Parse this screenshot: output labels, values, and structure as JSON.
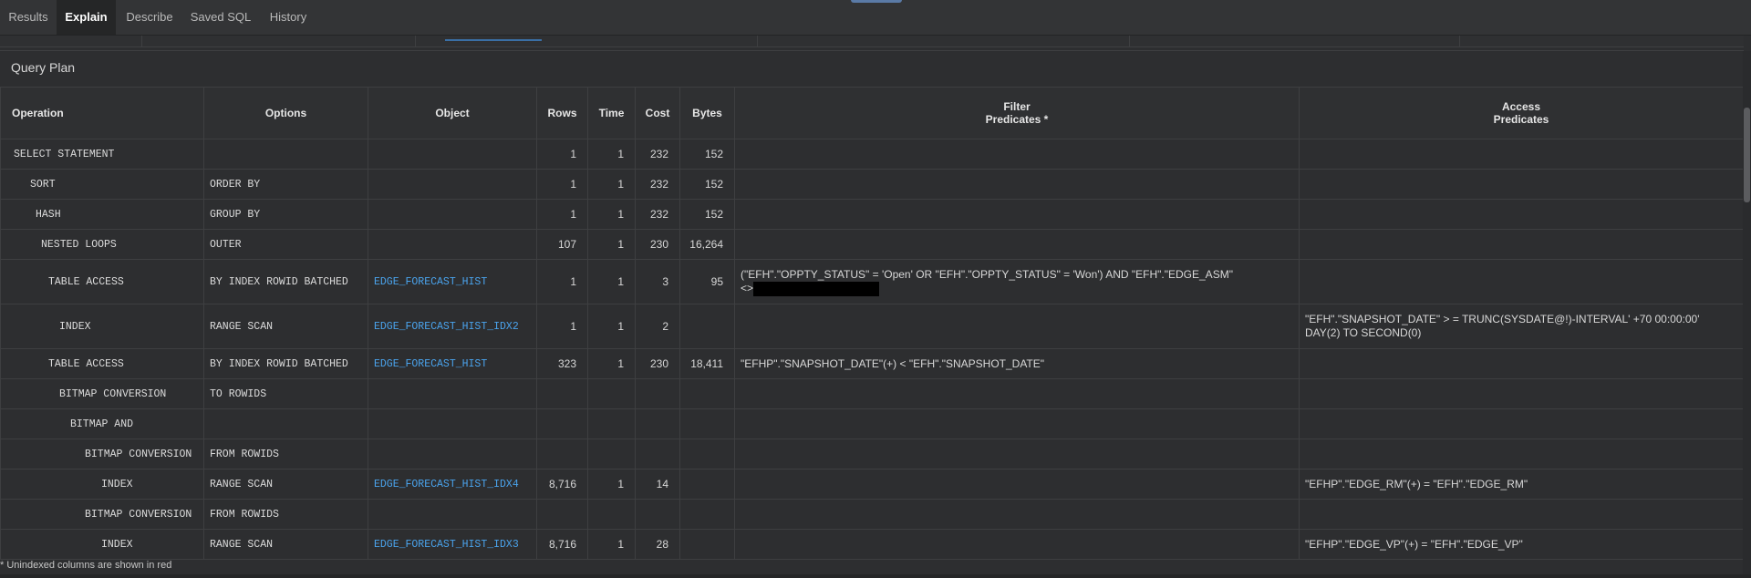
{
  "tabs": [
    {
      "label": "Results"
    },
    {
      "label": "Explain"
    },
    {
      "label": "Describe"
    },
    {
      "label": "Saved SQL"
    },
    {
      "label": "History"
    }
  ],
  "panel": {
    "title": "Query Plan"
  },
  "columns": {
    "operation": "Operation",
    "options": "Options",
    "object": "Object",
    "rows": "Rows",
    "time": "Time",
    "cost": "Cost",
    "bytes": "Bytes",
    "filter_line1": "Filter",
    "filter_line2": "Predicates *",
    "access_line1": "Access",
    "access_line2": "Predicates"
  },
  "plan": [
    {
      "operation": "SELECT STATEMENT",
      "indent": 0,
      "options": "",
      "object": "",
      "rows": "1",
      "time": "1",
      "cost": "232",
      "bytes": "152",
      "filter": "",
      "access": ""
    },
    {
      "operation": "SORT",
      "indent": 1,
      "options": "ORDER BY",
      "object": "",
      "rows": "1",
      "time": "1",
      "cost": "232",
      "bytes": "152",
      "filter": "",
      "access": ""
    },
    {
      "operation": "HASH",
      "indent": 2,
      "options": "GROUP BY",
      "object": "",
      "rows": "1",
      "time": "1",
      "cost": "232",
      "bytes": "152",
      "filter": "",
      "access": ""
    },
    {
      "operation": "NESTED LOOPS",
      "indent": 3,
      "options": "OUTER",
      "object": "",
      "rows": "107",
      "time": "1",
      "cost": "230",
      "bytes": "16,264",
      "filter": "",
      "access": ""
    },
    {
      "operation": "TABLE ACCESS",
      "indent": 4,
      "options": "BY INDEX ROWID BATCHED",
      "object": "EDGE_FORECAST_HIST",
      "rows": "1",
      "time": "1",
      "cost": "3",
      "bytes": "95",
      "filter": "(\"EFH\".\"OPPTY_STATUS\" = 'Open' OR \"EFH\".\"OPPTY_STATUS\" = 'Won') AND \"EFH\".\"EDGE_ASM\"",
      "filter_tail": "<>",
      "access": ""
    },
    {
      "operation": "INDEX",
      "indent": 5,
      "options": "RANGE SCAN",
      "object": "EDGE_FORECAST_HIST_IDX2",
      "rows": "1",
      "time": "1",
      "cost": "2",
      "bytes": "",
      "filter": "",
      "access": "\"EFH\".\"SNAPSHOT_DATE\" > = TRUNC(SYSDATE@!)-INTERVAL' +70 00:00:00' DAY(2) TO SECOND(0)"
    },
    {
      "operation": "TABLE ACCESS",
      "indent": 4,
      "options": "BY INDEX ROWID BATCHED",
      "object": "EDGE_FORECAST_HIST",
      "rows": "323",
      "time": "1",
      "cost": "230",
      "bytes": "18,411",
      "filter": "\"EFHP\".\"SNAPSHOT_DATE\"(+) < \"EFH\".\"SNAPSHOT_DATE\"",
      "access": ""
    },
    {
      "operation": "BITMAP CONVERSION",
      "indent": 5,
      "options": "TO ROWIDS",
      "object": "",
      "rows": "",
      "time": "",
      "cost": "",
      "bytes": "",
      "filter": "",
      "access": ""
    },
    {
      "operation": "BITMAP AND",
      "indent": 6,
      "options": "",
      "object": "",
      "rows": "",
      "time": "",
      "cost": "",
      "bytes": "",
      "filter": "",
      "access": ""
    },
    {
      "operation": "BITMAP CONVERSION",
      "indent": 7,
      "options": "FROM ROWIDS",
      "object": "",
      "rows": "",
      "time": "",
      "cost": "",
      "bytes": "",
      "filter": "",
      "access": ""
    },
    {
      "operation": "INDEX",
      "indent": 9,
      "options": "RANGE SCAN",
      "object": "EDGE_FORECAST_HIST_IDX4",
      "rows": "8,716",
      "time": "1",
      "cost": "14",
      "bytes": "",
      "filter": "",
      "access": "\"EFHP\".\"EDGE_RM\"(+) = \"EFH\".\"EDGE_RM\""
    },
    {
      "operation": "BITMAP CONVERSION",
      "indent": 7,
      "options": "FROM ROWIDS",
      "object": "",
      "rows": "",
      "time": "",
      "cost": "",
      "bytes": "",
      "filter": "",
      "access": ""
    },
    {
      "operation": "INDEX",
      "indent": 9,
      "options": "RANGE SCAN",
      "object": "EDGE_FORECAST_HIST_IDX3",
      "rows": "8,716",
      "time": "1",
      "cost": "28",
      "bytes": "",
      "filter": "",
      "access": "\"EFHP\".\"EDGE_VP\"(+) = \"EFH\".\"EDGE_VP\""
    }
  ],
  "footnote": "* Unindexed columns are shown in red",
  "colors": {
    "background": "#2d2e30",
    "link": "#4aa3ec",
    "header": "#2f3032",
    "border": "#3e3f41"
  }
}
